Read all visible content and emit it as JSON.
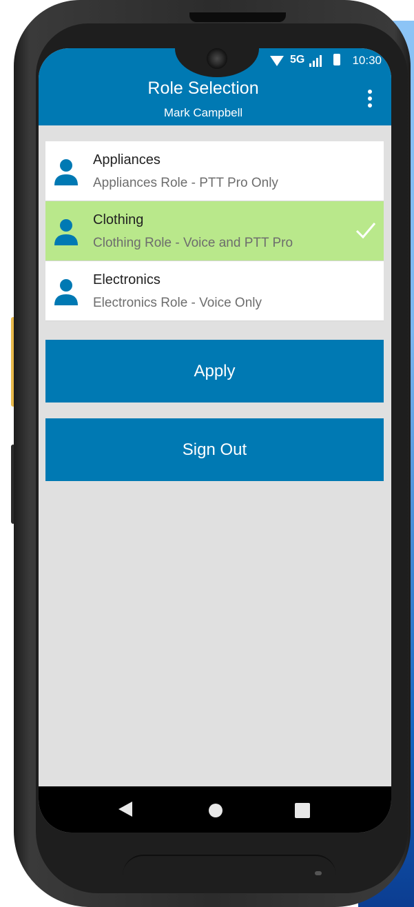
{
  "status_bar": {
    "network": "5G",
    "time": "10:30"
  },
  "app_bar": {
    "title": "Role Selection",
    "subtitle": "Mark Campbell",
    "menu_icon": "more-vert-icon"
  },
  "roles": [
    {
      "name": "Appliances",
      "description": "Appliances Role - PTT Pro Only",
      "selected": false
    },
    {
      "name": "Clothing",
      "description": "Clothing Role - Voice and PTT Pro",
      "selected": true
    },
    {
      "name": "Electronics",
      "description": "Electronics Role - Voice Only",
      "selected": false
    }
  ],
  "buttons": {
    "apply_label": "Apply",
    "sign_out_label": "Sign Out"
  },
  "colors": {
    "primary": "#0079b3",
    "selected_row": "#b9e88b",
    "background": "#e0e0e0"
  }
}
